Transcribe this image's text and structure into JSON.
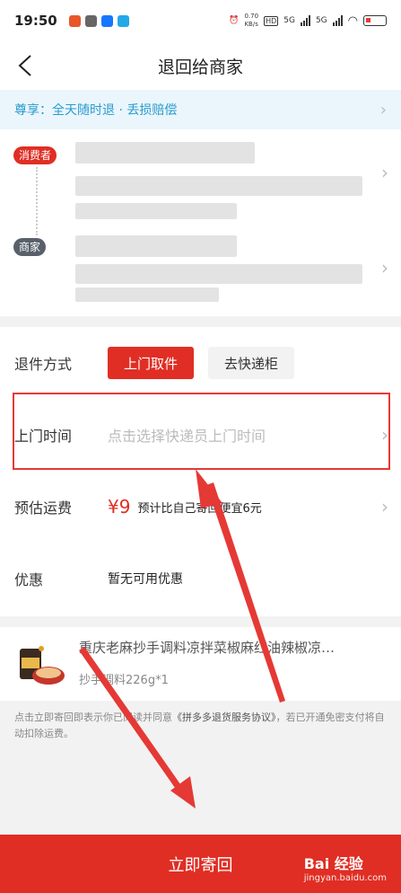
{
  "status": {
    "time": "19:50",
    "speed": "0.70\nKB/s",
    "hd": "HD",
    "net1": "5G",
    "net2": "5G"
  },
  "nav": {
    "title": "退回给商家"
  },
  "promo": {
    "text": "尊享：全天随时退 · 丢损赔偿"
  },
  "address": {
    "consumer_tag": "消费者",
    "merchant_tag": "商家"
  },
  "form": {
    "method_label": "退件方式",
    "method_pickup": "上门取件",
    "method_locker": "去快递柜",
    "time_label": "上门时间",
    "time_placeholder": "点击选择快递员上门时间",
    "fee_label": "预估运费",
    "fee_price": "¥9",
    "fee_note": "预计比自己寄回便宜6元",
    "coupon_label": "优惠",
    "coupon_value": "暂无可用优惠"
  },
  "product": {
    "title": "重庆老麻抄手调料凉拌菜椒麻红油辣椒凉…",
    "spec": "抄手调料226g*1"
  },
  "agreement": {
    "prefix": "点击立即寄回即表示你已阅读并同意",
    "link": "《拼多多退货服务协议》",
    "suffix": "，若已开通免密支付将自动扣除运费。"
  },
  "bottom": {
    "submit_label": "立即寄回"
  },
  "watermark": {
    "brand": "Bai 经验",
    "url": "jingyan.baidu.com"
  },
  "colors": {
    "accent": "#e02e24",
    "promo": "#2a9bd0",
    "annotation": "#e53935"
  }
}
